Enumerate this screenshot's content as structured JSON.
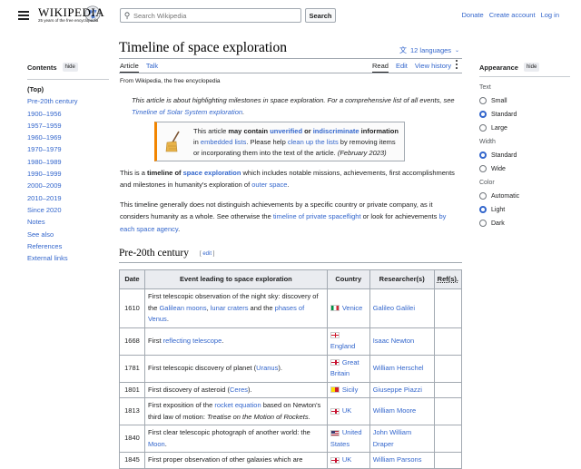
{
  "header": {
    "logo_word": "WIKIPEDIA",
    "logo_tagline": "25 years of the free encyclopedia",
    "search_placeholder": "Search Wikipedia",
    "search_button": "Search",
    "donate": "Donate",
    "create_account": "Create account",
    "login": "Log in"
  },
  "toc": {
    "title": "Contents",
    "hide": "hide",
    "items": [
      "(Top)",
      "Pre-20th century",
      "1900–1956",
      "1957–1959",
      "1960–1969",
      "1970–1979",
      "1980–1989",
      "1990–1999",
      "2000–2009",
      "2010–2019",
      "Since 2020",
      "Notes",
      "See also",
      "References",
      "External links"
    ]
  },
  "article": {
    "title": "Timeline of space exploration",
    "languages": "12 languages",
    "tabs_left": [
      "Article",
      "Talk"
    ],
    "tabs_right": [
      "Read",
      "Edit",
      "View history"
    ],
    "from": "From Wikipedia, the free encyclopedia",
    "hatnote_pre": "This article is about highlighting milestones in space exploration. For a comprehensive list of all events, see ",
    "hatnote_link": "Timeline of Solar System exploration",
    "hatnote_post": ".",
    "ambox": {
      "t1": "This article ",
      "t2": "may contain",
      "t3": "unverified",
      "t4": " or ",
      "t5": "indiscriminate",
      "t6": " information",
      "t7": " in ",
      "t8": "embedded lists",
      "t9": ". Please help ",
      "t10": "clean up the lists",
      "t11": " by removing items or incorporating them into the text of the article. ",
      "t12": "(February 2023)"
    },
    "p1": {
      "a": "This is a ",
      "b": "timeline of",
      "c": "space exploration",
      "d": " which includes notable missions, achievements, first accomplishments and milestones in humanity's exploration of ",
      "e": "outer space",
      "f": "."
    },
    "p2": {
      "a": "This timeline generally does not distinguish achievements by a specific country or private company, as it considers humanity as a whole. See otherwise the ",
      "b": "timeline of private spaceflight",
      "c": " or look for achievements ",
      "d": "by each space agency",
      "e": "."
    },
    "section_title": "Pre-20th century",
    "section_edit": "edit"
  },
  "table": {
    "headers": [
      "Date",
      "Event leading to space exploration",
      "Country",
      "Researcher(s)",
      "Ref(s)."
    ],
    "rows": [
      {
        "date": "1610",
        "event": [
          [
            "First telescopic observation of the night sky: discovery of the ",
            false
          ],
          [
            "Galilean moons",
            true
          ],
          [
            ", ",
            false
          ],
          [
            "lunar craters",
            true
          ],
          [
            " and the ",
            false
          ],
          [
            "phases of Venus",
            true
          ],
          [
            ".",
            false
          ]
        ],
        "flag": "it",
        "country": "Venice",
        "researcher": "Galileo Galilei"
      },
      {
        "date": "1668",
        "event": [
          [
            "First ",
            false
          ],
          [
            "reflecting telescope",
            true
          ],
          [
            ".",
            false
          ]
        ],
        "flag": "en",
        "country": "England",
        "researcher": "Isaac Newton"
      },
      {
        "date": "1781",
        "event": [
          [
            "First telescopic discovery of planet (",
            false
          ],
          [
            "Uranus",
            true
          ],
          [
            ").",
            false
          ]
        ],
        "flag": "gb",
        "country": "Great Britain",
        "researcher": "William Herschel"
      },
      {
        "date": "1801",
        "event": [
          [
            "First discovery of asteroid (",
            false
          ],
          [
            "Ceres",
            true
          ],
          [
            ").",
            false
          ]
        ],
        "flag": "si",
        "country": "Sicily",
        "researcher": "Giuseppe Piazzi"
      },
      {
        "date": "1813",
        "event": [
          [
            "First exposition of the ",
            false
          ],
          [
            "rocket equation",
            true
          ],
          [
            " based on Newton's third law of motion: ",
            false
          ],
          [
            "Treatise on the Motion of Rockets",
            "i"
          ],
          [
            ".",
            false
          ]
        ],
        "flag": "uk",
        "country": "UK",
        "researcher": "William Moore"
      },
      {
        "date": "1840",
        "event": [
          [
            "First clear telescopic photograph of another world: the ",
            false
          ],
          [
            "Moon",
            true
          ],
          [
            ".",
            false
          ]
        ],
        "flag": "us",
        "country": "United States",
        "researcher": "John William Draper"
      },
      {
        "date": "1845",
        "event": [
          [
            "First proper observation of other galaxies which are ",
            false
          ]
        ],
        "flag": "uk",
        "country": "UK",
        "researcher": "William Parsons"
      }
    ]
  },
  "appearance": {
    "title": "Appearance",
    "hide": "hide",
    "groups": [
      {
        "label": "Text",
        "options": [
          "Small",
          "Standard",
          "Large"
        ],
        "selected": 1
      },
      {
        "label": "Width",
        "options": [
          "Standard",
          "Wide"
        ],
        "selected": 0
      },
      {
        "label": "Color",
        "options": [
          "Automatic",
          "Light",
          "Dark"
        ],
        "selected": 1
      }
    ]
  }
}
